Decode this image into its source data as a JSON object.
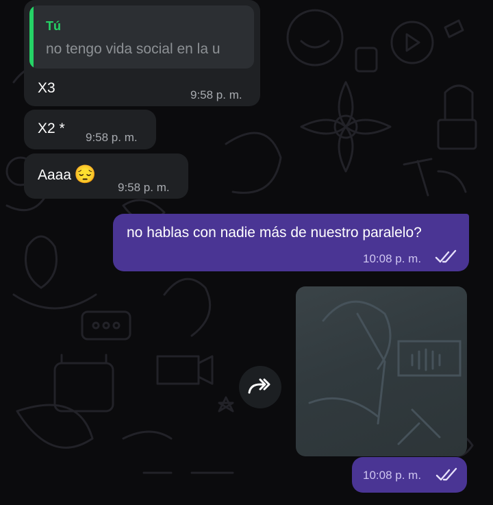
{
  "messages": [
    {
      "reply_author": "Tú",
      "reply_text": "no tengo vida social en la u",
      "text": "X3",
      "time": "9:58 p. m."
    },
    {
      "text": "X2 *",
      "time": "9:58 p. m."
    },
    {
      "text": "Aaaa",
      "time": "9:58 p. m.",
      "emoji": "😔"
    },
    {
      "text": "no hablas con nadie más de nuestro paralelo?",
      "time": "10:08 p. m.",
      "status": "read"
    },
    {
      "time": "10:08 p. m.",
      "status": "read",
      "attachment": "image"
    }
  ],
  "icons": {
    "forward": "forward-arrow-icon",
    "read_receipt": "double-check-icon"
  },
  "colors": {
    "incoming": "#1f2124",
    "outgoing": "#4a3594",
    "accent": "#25d366",
    "background": "#0b0b0d"
  }
}
